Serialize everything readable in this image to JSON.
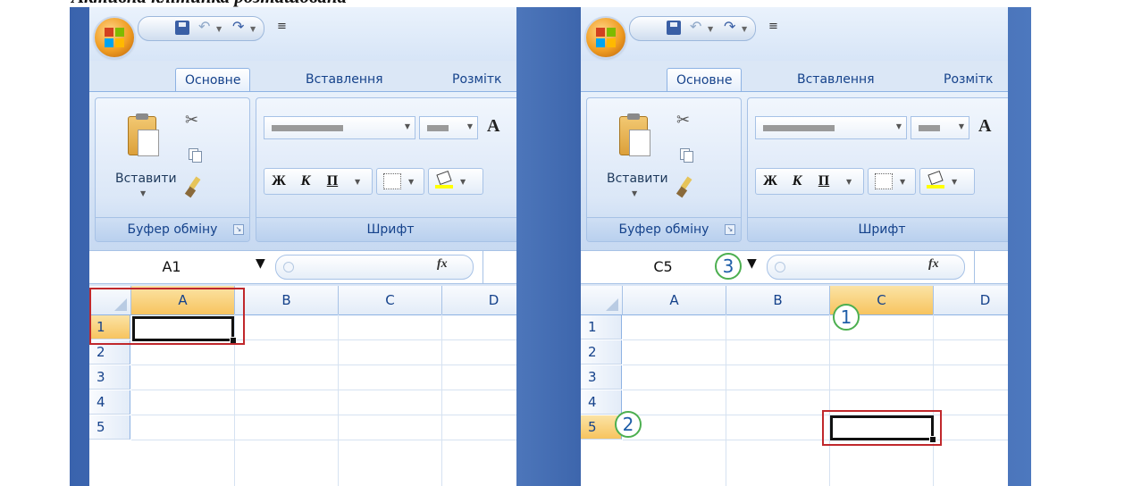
{
  "heading": "Активна клітинка розташована",
  "colors": {
    "accent_red": "#c0282c",
    "callout_green": "#4caf50",
    "selected_header": "#f7c45f",
    "office_orange": "#f09d22"
  },
  "panes": [
    {
      "qat": {
        "save_icon": "save-icon",
        "undo_icon": "undo-icon",
        "redo_icon": "redo-icon"
      },
      "tabs": [
        "Основне",
        "Вставлення",
        "Розмітк"
      ],
      "clipboard": {
        "paste_label": "Вставити",
        "group_label": "Буфер обміну"
      },
      "font": {
        "group_label": "Шрифт",
        "bold": "Ж",
        "italic": "К",
        "underline": "П",
        "grow_font": "A"
      },
      "namebox": "A1",
      "fx": "fx",
      "columns": [
        "A",
        "B",
        "C",
        "D"
      ],
      "rows": [
        "1",
        "2",
        "3",
        "4",
        "5"
      ]
    },
    {
      "qat": {
        "save_icon": "save-icon",
        "undo_icon": "undo-icon",
        "redo_icon": "redo-icon"
      },
      "tabs": [
        "Основне",
        "Вставлення",
        "Розмітк"
      ],
      "clipboard": {
        "paste_label": "Вставити",
        "group_label": "Буфер обміну"
      },
      "font": {
        "group_label": "Шрифт",
        "bold": "Ж",
        "italic": "К",
        "underline": "П",
        "grow_font": "A"
      },
      "namebox": "C5",
      "fx": "fx",
      "columns": [
        "A",
        "B",
        "C",
        "D"
      ],
      "rows": [
        "1",
        "2",
        "3",
        "4",
        "5"
      ],
      "callouts": [
        "1",
        "2",
        "3"
      ]
    }
  ]
}
